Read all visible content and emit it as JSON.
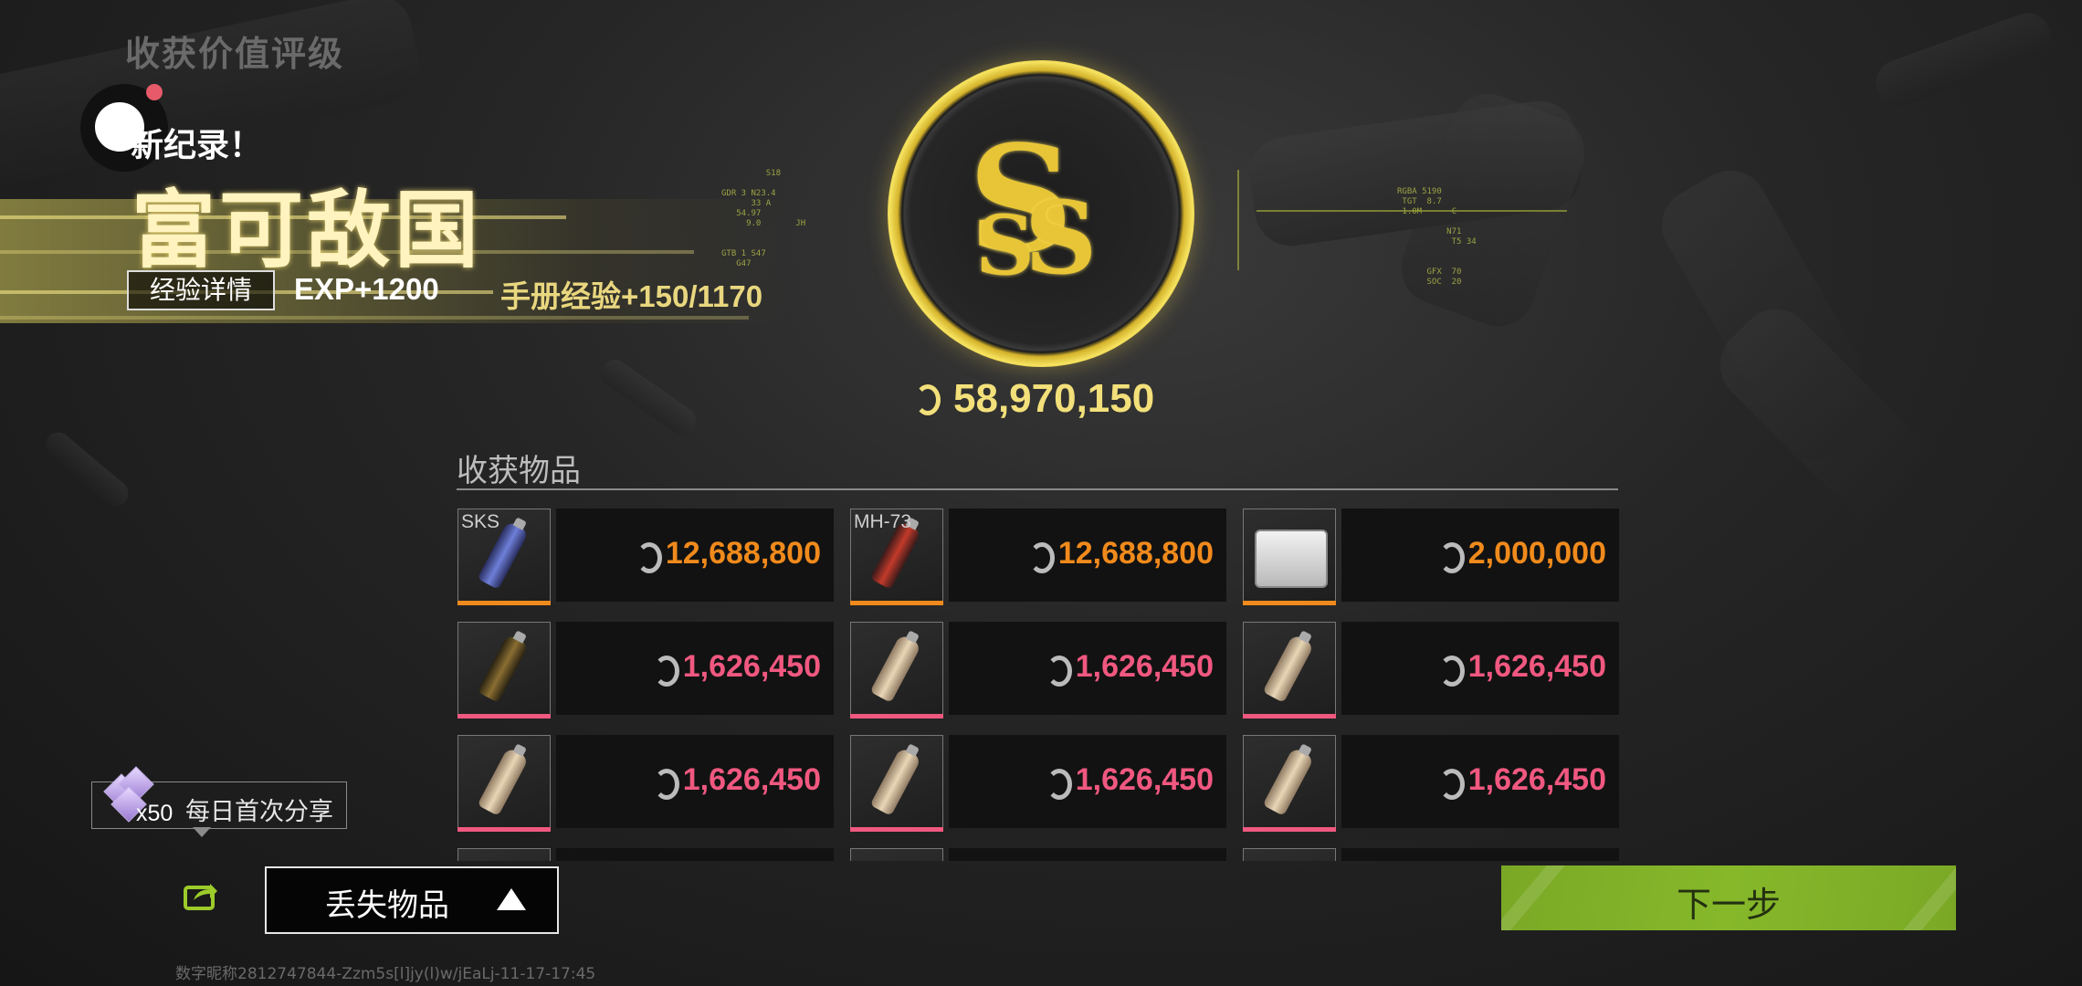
{
  "header": {
    "rating_title": "收获价值评级",
    "new_record": "新纪录！",
    "grade_title": "富可敌国",
    "exp_detail_button": "经验详情",
    "exp_gain": "EXP+1200",
    "handbook_exp": "手册经验+150/1170"
  },
  "medal": {
    "grade_letters": "SSS",
    "total_value": "58,970,150"
  },
  "harvest": {
    "section_title": "收获物品",
    "items": [
      {
        "tag": "SKS",
        "price": "12,688,800",
        "rarity": "orange",
        "art": "blue-can"
      },
      {
        "tag": "MH-73",
        "price": "12,688,800",
        "rarity": "orange",
        "art": "red-can"
      },
      {
        "tag": "",
        "price": "2,000,000",
        "rarity": "orange",
        "art": "white-crate"
      },
      {
        "tag": "",
        "price": "1,626,450",
        "rarity": "pink",
        "art": "gold-can"
      },
      {
        "tag": "",
        "price": "1,626,450",
        "rarity": "pink",
        "art": "cream-can"
      },
      {
        "tag": "",
        "price": "1,626,450",
        "rarity": "pink",
        "art": "cream-can"
      },
      {
        "tag": "",
        "price": "1,626,450",
        "rarity": "pink",
        "art": "cream-can"
      },
      {
        "tag": "",
        "price": "1,626,450",
        "rarity": "pink",
        "art": "cream-can"
      },
      {
        "tag": "",
        "price": "1,626,450",
        "rarity": "pink",
        "art": "cream-can"
      }
    ]
  },
  "share_tip": {
    "count": "x50",
    "text": "每日首次分享"
  },
  "bottom": {
    "lost_items_button": "丢失物品",
    "next_button": "下一步",
    "footer_id": "数字昵称2812747844-Zzm5s[l]jy(l)w/jEaLj-11-17-17:45"
  },
  "colors": {
    "orange_rarity": "#f08a1c",
    "pink_rarity": "#f05880",
    "next_button": "#86b82a",
    "medal_gold": "#e8c536"
  }
}
